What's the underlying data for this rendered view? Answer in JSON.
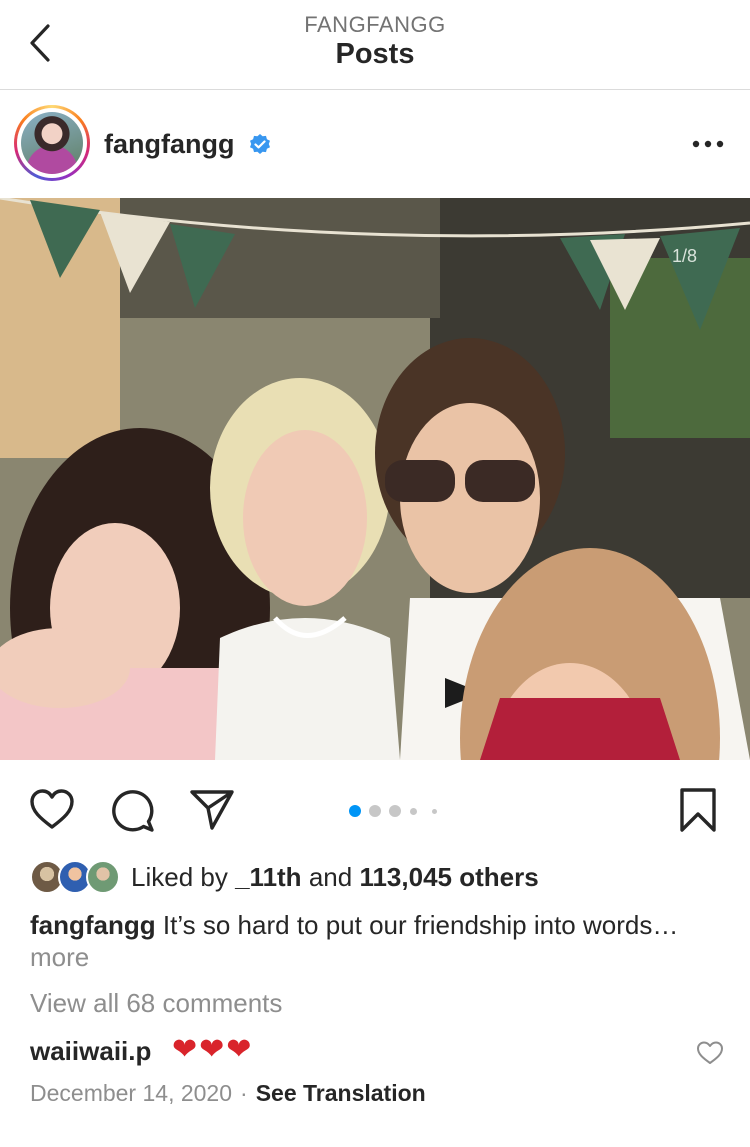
{
  "header": {
    "username": "FANGFANGG",
    "title": "Posts"
  },
  "post": {
    "username": "fangfangg",
    "verified": true,
    "photo_index": "1/8",
    "carousel": {
      "count": 5,
      "active": 0
    },
    "likes": {
      "prefix": "Liked by",
      "first_user": "_11th",
      "conjunction": "and",
      "others": "113,045 others"
    },
    "caption": {
      "username": "fangfangg",
      "text": "It’s so hard to put our friendship into words…",
      "more_label": "more"
    },
    "view_comments": "View all 68 comments",
    "comment": {
      "username": "waiiwaii.p",
      "text": "❤❤❤"
    },
    "date": "December 14, 2020",
    "separator": "·",
    "see_translation": "See Translation"
  },
  "icons": {
    "back": "chevron-left-icon",
    "more": "more-horizontal-icon",
    "like": "heart-icon",
    "comment": "comment-bubble-icon",
    "share": "paper-plane-icon",
    "save": "bookmark-icon",
    "verified": "verified-badge-icon"
  },
  "colors": {
    "accent": "#0095f6",
    "verified": "#3897f0",
    "muted": "#8e8e8e",
    "text": "#262626",
    "heart": "#d9242b"
  }
}
